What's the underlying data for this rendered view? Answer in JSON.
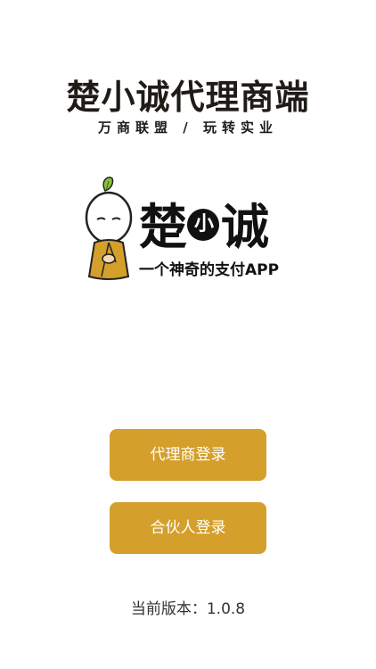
{
  "app": {
    "title": "楚小诚代理商端",
    "subtitle": "万商联盟 / 玩转实业"
  },
  "logo": {
    "name_left": "楚",
    "name_mid": "小",
    "name_right": "诚",
    "slogan": "一个神奇的支付APP",
    "icon": "monk-mascot-icon"
  },
  "buttons": {
    "agent_login": "代理商登录",
    "partner_login": "合伙人登录"
  },
  "footer": {
    "version_label": "当前版本：1.0.8"
  },
  "colors": {
    "accent": "#d49f2b",
    "text_dark": "#1f1b16"
  }
}
